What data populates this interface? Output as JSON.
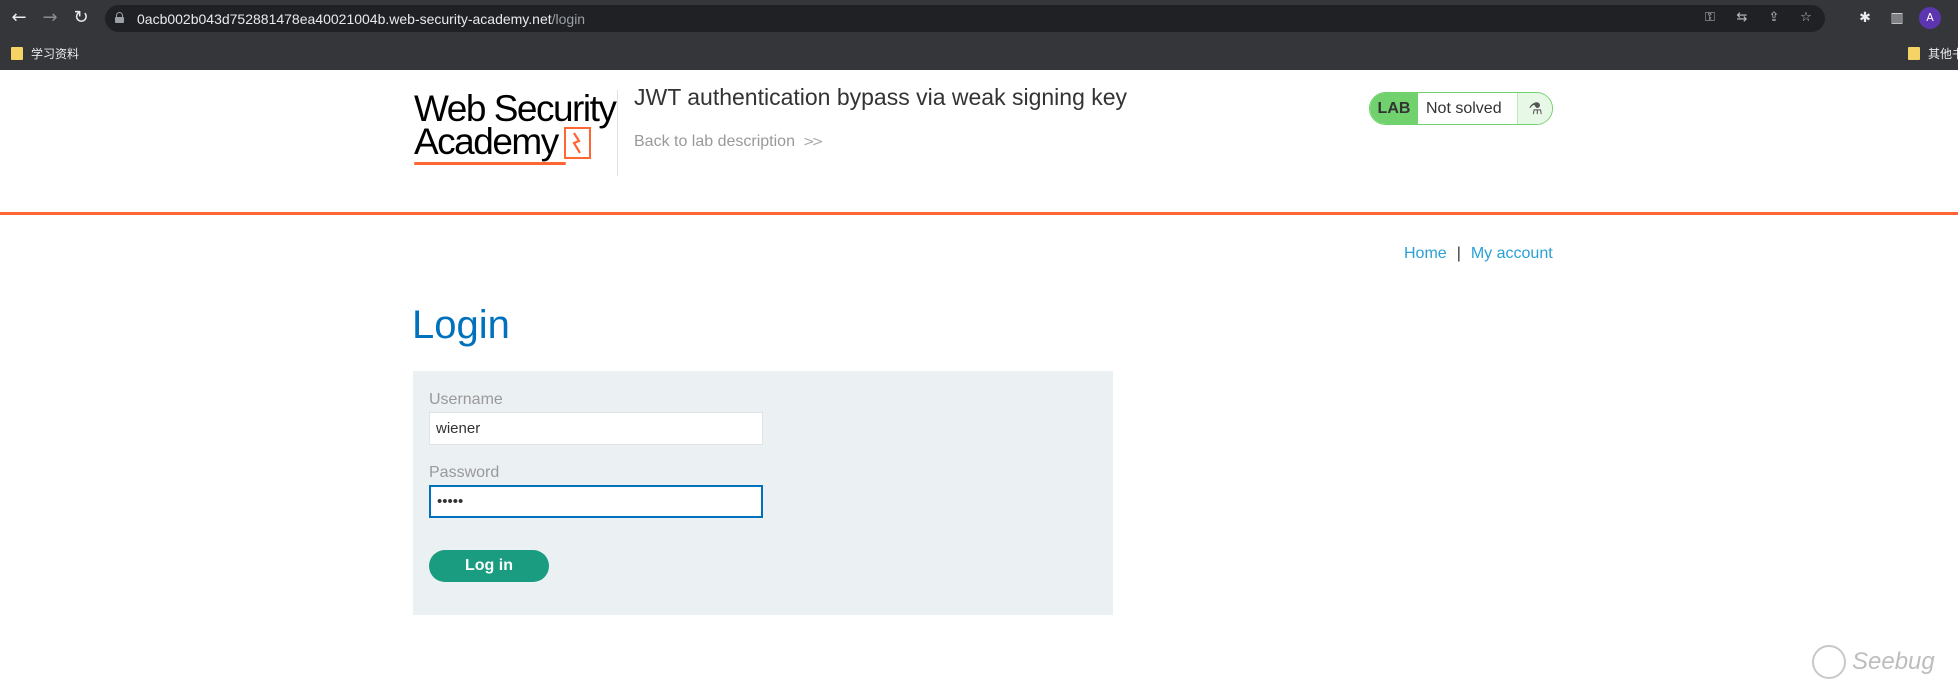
{
  "browser": {
    "url_host": "0acb002b043d752881478ea40021004b.web-security-academy.net",
    "url_path": "/login",
    "nav_icons": [
      "back-arrow-icon",
      "forward-arrow-icon",
      "reload-icon"
    ],
    "omnibox_icons": [
      "key-icon",
      "translate-icon",
      "share-icon",
      "star-icon"
    ],
    "toolbar_icons": [
      "extensions-icon",
      "side-panel-icon"
    ],
    "avatar_letter": "A",
    "bookmarks": [
      {
        "label": "学习资料"
      },
      {
        "label": "其他书"
      }
    ]
  },
  "header": {
    "logo_line1": "Web Security",
    "logo_line2": "Academy",
    "lab_title": "JWT authentication bypass via weak signing key",
    "back_link": "Back to lab description",
    "status_tag": "LAB",
    "status_text": "Not solved",
    "colors": {
      "accent": "#ff6633",
      "status_green": "#70d16d"
    }
  },
  "nav": {
    "home": "Home",
    "separator": "|",
    "my_account": "My account"
  },
  "login": {
    "title": "Login",
    "username_label": "Username",
    "username_value": "wiener",
    "password_label": "Password",
    "password_value": "•••••",
    "submit_label": "Log in"
  },
  "watermark": "Seebug"
}
